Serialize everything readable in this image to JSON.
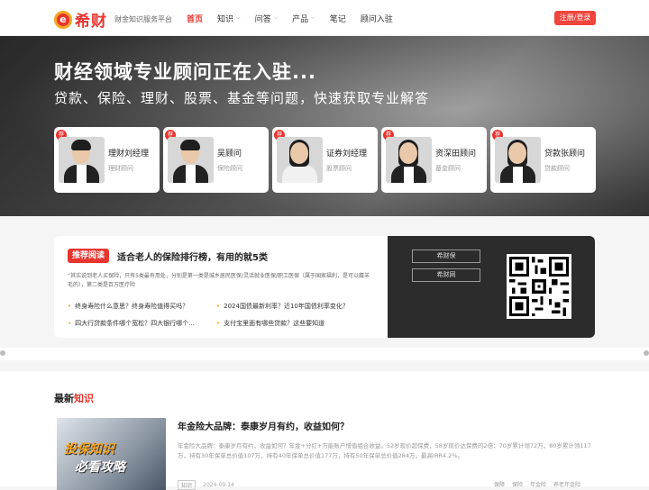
{
  "header": {
    "logo_mark": "e",
    "logo_name": "希财",
    "slogan": "财金知识服务平台",
    "nav": [
      {
        "label": "首页",
        "active": true,
        "dropdown": false
      },
      {
        "label": "知识",
        "active": false,
        "dropdown": true
      },
      {
        "label": "问答",
        "active": false,
        "dropdown": true
      },
      {
        "label": "产品",
        "active": false,
        "dropdown": true
      },
      {
        "label": "笔记",
        "active": false,
        "dropdown": false
      },
      {
        "label": "顾问入驻",
        "active": false,
        "dropdown": false
      }
    ],
    "login_label": "注册/登录"
  },
  "hero": {
    "title": "财经领域专业顾问正在入驻...",
    "subtitle": "贷款、保险、理财、股票、基金等问题，快速获取专业解答",
    "badge": "荐",
    "advisors": [
      {
        "name": "理财刘经理",
        "role": "理财顾问",
        "gender": "male"
      },
      {
        "name": "吴顾问",
        "role": "保险顾问",
        "gender": "male"
      },
      {
        "name": "证券刘经理",
        "role": "股票顾问",
        "gender": "female"
      },
      {
        "name": "资深田顾问",
        "role": "基金顾问",
        "gender": "female"
      },
      {
        "name": "贷款张顾问",
        "role": "贷款顾问",
        "gender": "female"
      }
    ]
  },
  "recommend": {
    "tag": "推荐阅读",
    "title": "适合老人的保险排行榜，有用的就5类",
    "desc": "“其实说到老人买保险，只有5类最有用处，分别是第一类是城乡居民医保/灵活就业医保/职工医保（属于国家福利，是可以薅羊毛的），第二类是百万医疗险",
    "links": [
      "终身寿险什么意思？终身寿险值得买吗？",
      "2024国债最新利率？近10年国债利率变化？",
      "四大行贷款条件哪个宽松？四大银行哪个...",
      "支付宝里面有哪些贷款？这些要知道"
    ],
    "buttons": [
      "希财保",
      "希财网"
    ]
  },
  "latest": {
    "section_title_prefix": "最新",
    "section_title_highlight": "知识",
    "thumb_line1": "投保知识",
    "thumb_line2": "必看攻略",
    "article_title": "年金险大品牌：泰康岁月有约，收益如何？",
    "article_summary": "年金险大品牌：泰康岁月有约，收益如何？年金+分红+万能账户增值组合收益。52岁现价超保费，58岁现价达保费的2倍；70岁累计领72万，80岁累计领117万，持有30年保单总价值107万，持有40年保单总价值177万，持有50年保单总价值284万，最高IRR4.2%。",
    "category": "知识",
    "date": "2024-09-14",
    "tags": [
      "保障",
      "保险",
      "年金险",
      "养老年金险"
    ]
  }
}
